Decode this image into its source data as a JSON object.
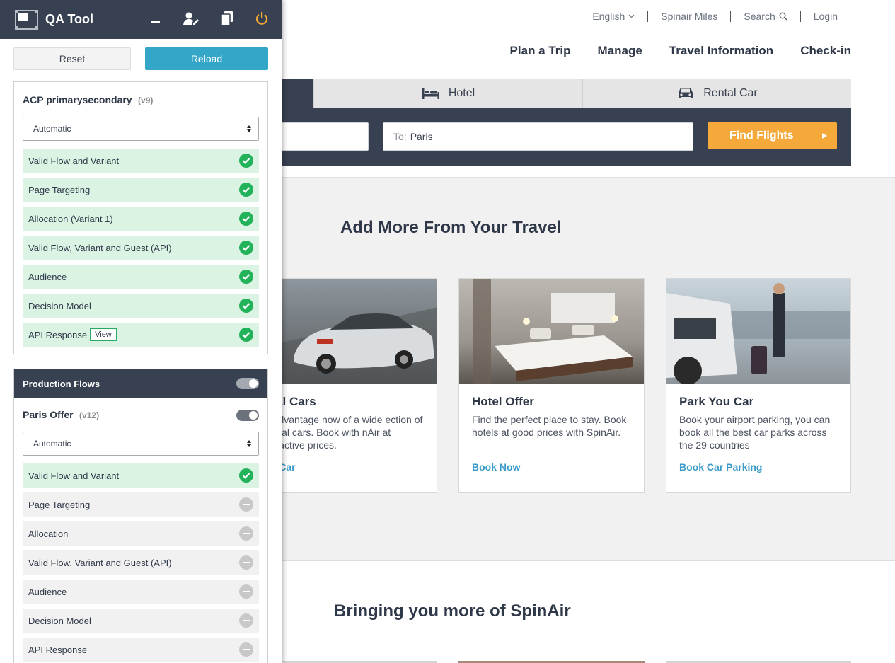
{
  "site": {
    "util_nav": [
      "English",
      "Spinair Miles",
      "Search",
      "Login"
    ],
    "main_nav": [
      "Plan a Trip",
      "Manage",
      "Travel Information",
      "Check-in"
    ],
    "tabs": [
      "Hotel",
      "Rental Car"
    ],
    "search": {
      "to_label": "To:",
      "to_value": "Paris",
      "find_label": "Find Flights"
    },
    "section_title": "Add More From Your Travel",
    "section2_title": "Bringing you more of SpinAir",
    "cards": [
      {
        "title": "ntal Cars",
        "text": "e advantage now of a wide ection of rental cars. Book with nAir at attractive prices.",
        "cta": "t a Car"
      },
      {
        "title": "Hotel Offer",
        "text": "Find the perfect place to stay. Book hotels at good prices with SpinAir.",
        "cta": "Book Now"
      },
      {
        "title": "Park You Car",
        "text": "Book your airport parking, you can book all the best car parks across the 29 countries",
        "cta": "Book Car Parking"
      }
    ],
    "colors": {
      "accent": "#f5a93a",
      "navy": "#384151",
      "link": "#3b9bc8"
    }
  },
  "qa": {
    "title": "QA Tool",
    "icons": [
      "minimize-icon",
      "user-edit-icon",
      "copy-icon",
      "power-icon"
    ],
    "reset_label": "Reset",
    "reload_label": "Reload",
    "campaign": {
      "name": "ACP primarysecondary",
      "version": "(v9)",
      "select_value": "Automatic",
      "checks": [
        {
          "label": "Valid Flow and Variant",
          "status": "ok"
        },
        {
          "label": "Page Targeting",
          "status": "ok"
        },
        {
          "label": "Allocation (Variant 1)",
          "status": "ok"
        },
        {
          "label": "Valid Flow, Variant and Guest (API)",
          "status": "ok"
        },
        {
          "label": "Audience",
          "status": "ok"
        },
        {
          "label": "Decision Model",
          "status": "ok"
        },
        {
          "label": "API Response",
          "status": "ok",
          "view": "View"
        }
      ]
    },
    "production": {
      "header": "Production Flows",
      "flow_name": "Paris Offer",
      "flow_version": "(v12)",
      "select_value": "Automatic",
      "checks": [
        {
          "label": "Valid Flow and Variant",
          "status": "ok"
        },
        {
          "label": "Page Targeting",
          "status": "na"
        },
        {
          "label": "Allocation",
          "status": "na"
        },
        {
          "label": "Valid Flow, Variant and Guest (API)",
          "status": "na"
        },
        {
          "label": "Audience",
          "status": "na"
        },
        {
          "label": "Decision Model",
          "status": "na"
        },
        {
          "label": "API Response",
          "status": "na"
        }
      ]
    }
  }
}
